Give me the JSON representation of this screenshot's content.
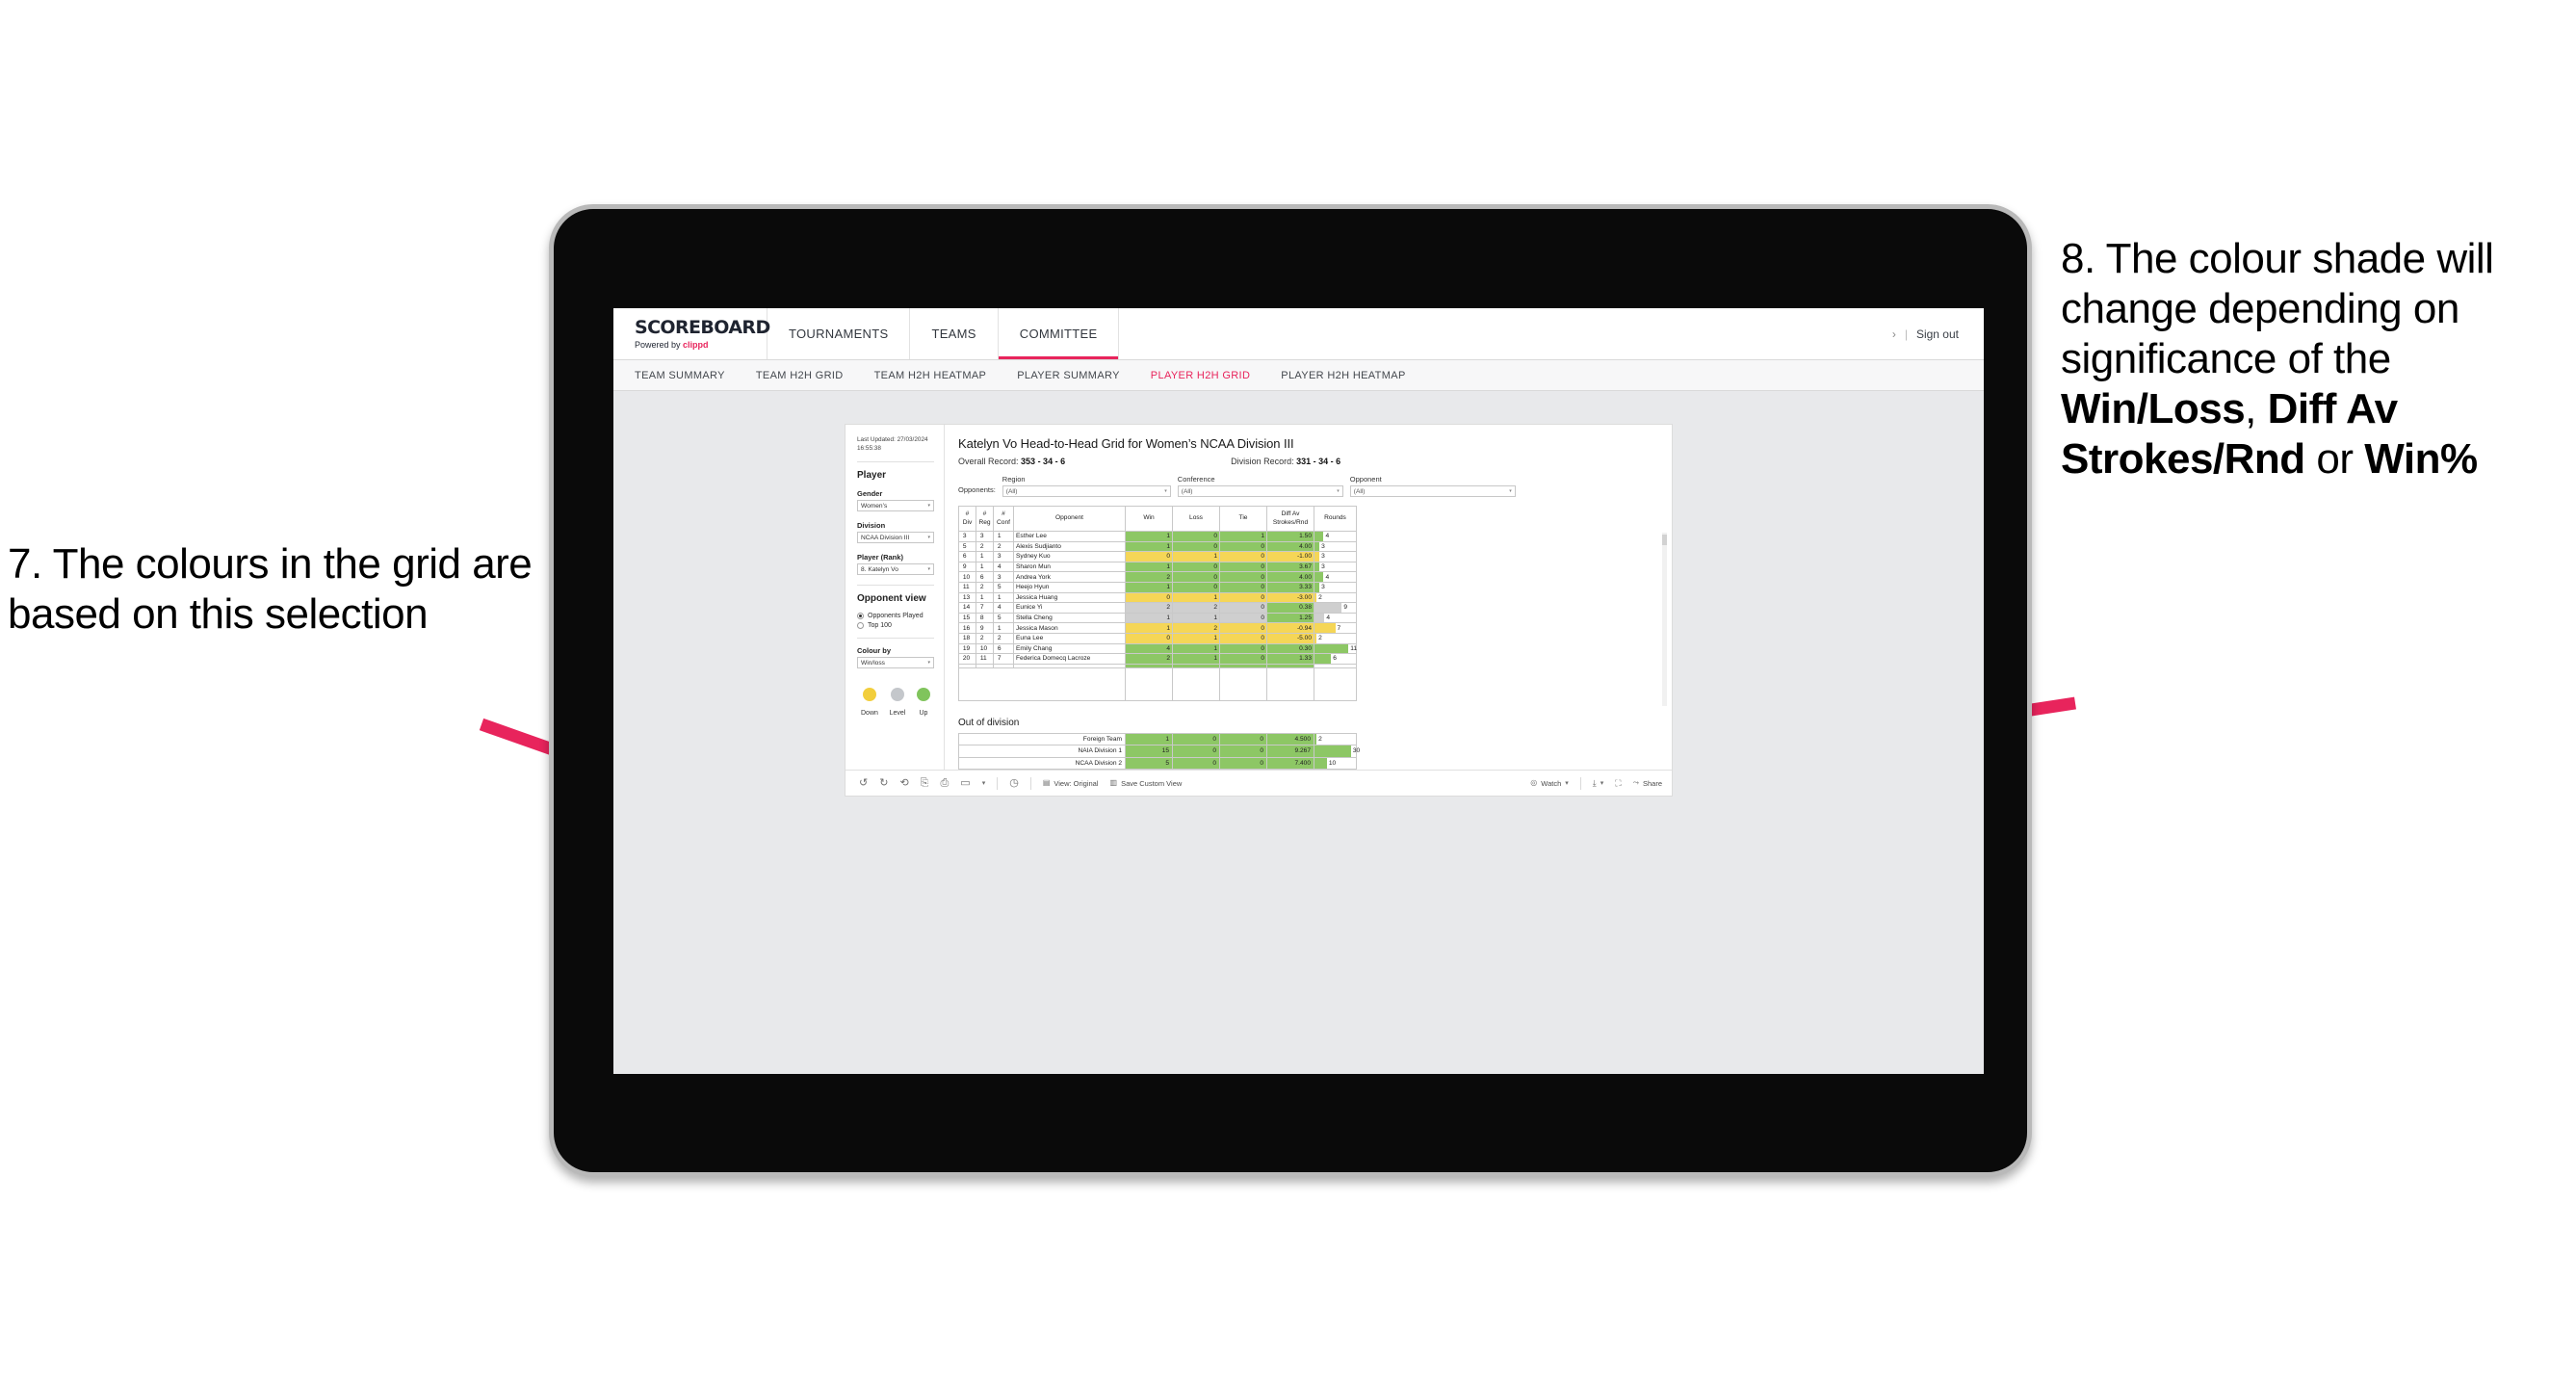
{
  "annotations": {
    "left": "7. The colours in the grid are based on this selection",
    "right_parts": [
      {
        "text": "8. The colour shade will change depending on significance of the ",
        "bold": false
      },
      {
        "text": "Win/Loss",
        "bold": true
      },
      {
        "text": ", ",
        "bold": false
      },
      {
        "text": "Diff Av Strokes/Rnd",
        "bold": true
      },
      {
        "text": " or ",
        "bold": false
      },
      {
        "text": "Win%",
        "bold": true
      }
    ],
    "arrow_color": "#E8245C"
  },
  "header": {
    "logo_title": "SCOREBOARD",
    "logo_sub_prefix": "Powered by ",
    "logo_sub_brand": "clippd",
    "nav": [
      {
        "label": "TOURNAMENTS",
        "active": false
      },
      {
        "label": "TEAMS",
        "active": false
      },
      {
        "label": "COMMITTEE",
        "active": true
      }
    ],
    "chevron": "›",
    "divider": "|",
    "sign_out": "Sign out"
  },
  "subnav": [
    {
      "label": "TEAM SUMMARY",
      "active": false
    },
    {
      "label": "TEAM H2H GRID",
      "active": false
    },
    {
      "label": "TEAM H2H HEATMAP",
      "active": false
    },
    {
      "label": "PLAYER SUMMARY",
      "active": false
    },
    {
      "label": "PLAYER H2H GRID",
      "active": true
    },
    {
      "label": "PLAYER H2H HEATMAP",
      "active": false
    }
  ],
  "sidebar": {
    "last_updated_label": "Last Updated: 27/03/2024",
    "last_updated_time": "16:55:38",
    "player_heading": "Player",
    "gender_label": "Gender",
    "gender_value": "Women’s",
    "division_label": "Division",
    "division_value": "NCAA Division III",
    "player_rank_label": "Player (Rank)",
    "player_rank_value": "8. Katelyn Vo",
    "opponent_view_heading": "Opponent view",
    "opponent_view_options": [
      {
        "label": "Opponents Played",
        "selected": true
      },
      {
        "label": "Top 100",
        "selected": false
      }
    ],
    "colour_by_label": "Colour by",
    "colour_by_value": "Win/loss",
    "legend": [
      {
        "caption": "Down",
        "color": "#F2CE3C"
      },
      {
        "caption": "Level",
        "color": "#C4C7CB"
      },
      {
        "caption": "Up",
        "color": "#80C45C"
      }
    ]
  },
  "viz": {
    "title": "Katelyn Vo Head-to-Head Grid for Women’s NCAA Division III",
    "overall_record_label": "Overall Record:",
    "overall_record_value": "353 -  34 - 6",
    "division_record_label": "Division Record:",
    "division_record_value": "331 -  34 - 6",
    "opponents_label": "Opponents:",
    "filters": [
      {
        "label": "Region",
        "value": "(All)"
      },
      {
        "label": "Conference",
        "value": "(All)"
      },
      {
        "label": "Opponent",
        "value": "(All)"
      }
    ],
    "columns": [
      "# Div",
      "# Reg",
      "# Conf",
      "Opponent",
      "Win",
      "Loss",
      "Tie",
      "Diff Av Strokes/Rnd",
      "Rounds"
    ],
    "column_lines": [
      [
        "#",
        "Div"
      ],
      [
        "#",
        "Reg"
      ],
      [
        "#",
        "Conf"
      ],
      [
        "Opponent"
      ],
      [
        "Win"
      ],
      [
        "Loss"
      ],
      [
        "Tie"
      ],
      [
        "Diff Av",
        "Strokes/Rnd"
      ],
      [
        "Rounds"
      ]
    ],
    "rows": [
      {
        "div": "3",
        "reg": "3",
        "conf": "1",
        "opponent": "Esther Lee",
        "win": "1",
        "loss": "0",
        "tie": "1",
        "diff": "1.50",
        "rounds": "4",
        "shade": "green",
        "bar_pct": 22
      },
      {
        "div": "5",
        "reg": "2",
        "conf": "2",
        "opponent": "Alexis Sudjianto",
        "win": "1",
        "loss": "0",
        "tie": "0",
        "diff": "4.00",
        "rounds": "3",
        "shade": "green",
        "bar_pct": 12
      },
      {
        "div": "6",
        "reg": "1",
        "conf": "3",
        "opponent": "Sydney Kuo",
        "win": "0",
        "loss": "1",
        "tie": "0",
        "diff": "-1.00",
        "rounds": "3",
        "shade": "yellow",
        "bar_pct": 12
      },
      {
        "div": "9",
        "reg": "1",
        "conf": "4",
        "opponent": "Sharon Mun",
        "win": "1",
        "loss": "0",
        "tie": "0",
        "diff": "3.67",
        "rounds": "3",
        "shade": "green",
        "bar_pct": 12
      },
      {
        "div": "10",
        "reg": "6",
        "conf": "3",
        "opponent": "Andrea York",
        "win": "2",
        "loss": "0",
        "tie": "0",
        "diff": "4.00",
        "rounds": "4",
        "shade": "green",
        "bar_pct": 22
      },
      {
        "div": "11",
        "reg": "2",
        "conf": "5",
        "opponent": "Heejo Hyun",
        "win": "1",
        "loss": "0",
        "tie": "0",
        "diff": "3.33",
        "rounds": "3",
        "shade": "green",
        "bar_pct": 12
      },
      {
        "div": "13",
        "reg": "1",
        "conf": "1",
        "opponent": "Jessica Huang",
        "win": "0",
        "loss": "1",
        "tie": "0",
        "diff": "-3.00",
        "rounds": "2",
        "shade": "yellow",
        "bar_pct": 5
      },
      {
        "div": "14",
        "reg": "7",
        "conf": "4",
        "opponent": "Eunice Yi",
        "win": "2",
        "loss": "2",
        "tie": "0",
        "diff": "0.38",
        "rounds": "9",
        "shade": "grey",
        "diff_shade": "green",
        "bar_pct": 66
      },
      {
        "div": "15",
        "reg": "8",
        "conf": "5",
        "opponent": "Stella Cheng",
        "win": "1",
        "loss": "1",
        "tie": "0",
        "diff": "1.25",
        "rounds": "4",
        "shade": "grey",
        "diff_shade": "green",
        "bar_pct": 24
      },
      {
        "div": "16",
        "reg": "9",
        "conf": "1",
        "opponent": "Jessica Mason",
        "win": "1",
        "loss": "2",
        "tie": "0",
        "diff": "-0.94",
        "rounds": "7",
        "shade": "yellow",
        "bar_pct": 50
      },
      {
        "div": "18",
        "reg": "2",
        "conf": "2",
        "opponent": "Euna Lee",
        "win": "0",
        "loss": "1",
        "tie": "0",
        "diff": "-5.00",
        "rounds": "2",
        "shade": "yellow",
        "bar_pct": 5
      },
      {
        "div": "19",
        "reg": "10",
        "conf": "6",
        "opponent": "Emily Chang",
        "win": "4",
        "loss": "1",
        "tie": "0",
        "diff": "0.30",
        "rounds": "11",
        "shade": "green",
        "bar_pct": 82
      },
      {
        "div": "20",
        "reg": "11",
        "conf": "7",
        "opponent": "Federica Domecq Lacroze",
        "win": "2",
        "loss": "1",
        "tie": "0",
        "diff": "1.33",
        "rounds": "6",
        "shade": "green",
        "bar_pct": 40
      }
    ],
    "out_of_division_heading": "Out of division",
    "out_of_division_rows": [
      {
        "name": "Foreign Team",
        "win": "1",
        "loss": "0",
        "tie": "0",
        "diff": "4.500",
        "rounds": "2",
        "shade": "green",
        "bar_pct": 5
      },
      {
        "name": "NAIA Division 1",
        "win": "15",
        "loss": "0",
        "tie": "0",
        "diff": "9.267",
        "rounds": "30",
        "shade": "green",
        "bar_pct": 88
      },
      {
        "name": "NCAA Division 2",
        "win": "5",
        "loss": "0",
        "tie": "0",
        "diff": "7.400",
        "rounds": "10",
        "shade": "green",
        "bar_pct": 30
      }
    ]
  },
  "toolbar": {
    "icons": [
      "undo-icon",
      "redo-icon",
      "revert-icon",
      "refresh-data-icon",
      "pause-icon",
      "rectangle-select-icon",
      "caret-icon"
    ],
    "glyphs": [
      "↶",
      "↷",
      "↺",
      "⚇",
      "⛃",
      "▭",
      "▾",
      "❀"
    ],
    "view_original": "View: Original",
    "save_custom_view": "Save Custom View",
    "watch": "Watch",
    "share": "Share"
  }
}
